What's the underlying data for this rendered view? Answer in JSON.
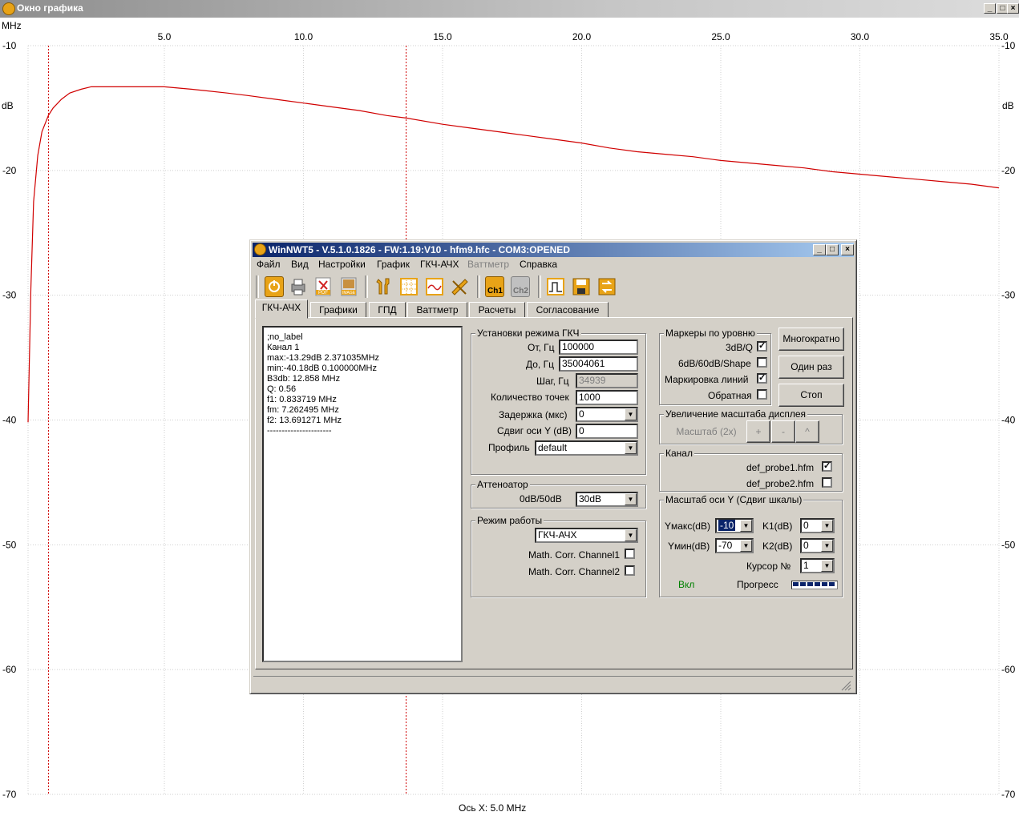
{
  "window": {
    "title": "Окно графика",
    "controls": [
      "_",
      "□",
      "×"
    ]
  },
  "plot": {
    "x_unit_label": "MHz",
    "y_unit_label": "dB",
    "footer": "Ось X: 5.0 MHz"
  },
  "chart_data": {
    "type": "line",
    "title": "",
    "xlabel": "Ось X: 5.0 MHz",
    "ylabel": "dB",
    "xlim": [
      0.1,
      35.0
    ],
    "ylim": [
      -70,
      -10
    ],
    "x_ticks": [
      "5.0",
      "10.0",
      "15.0",
      "20.0",
      "25.0",
      "30.0",
      "35.0"
    ],
    "y_ticks": [
      "-10",
      "-20",
      "-30",
      "-40",
      "-50",
      "-60",
      "-70"
    ],
    "grid": true,
    "markers_mhz": [
      0.833719,
      13.691271
    ],
    "series": [
      {
        "color": "#d00000",
        "x": [
          0.1,
          0.2,
          0.3,
          0.45,
          0.6,
          0.83,
          1.0,
          1.3,
          1.6,
          2.0,
          2.37,
          3.0,
          4.0,
          5.0,
          6.0,
          7.26,
          8.0,
          9.0,
          10.0,
          11.0,
          12.0,
          13.0,
          13.69,
          15.0,
          16.0,
          17.0,
          18.0,
          19.0,
          20.0,
          21.0,
          22.0,
          23.0,
          24.0,
          25.0,
          26.0,
          27.0,
          28.0,
          29.0,
          30.0,
          31.0,
          32.0,
          33.0,
          34.0,
          35.0
        ],
        "y": [
          -40.18,
          -29.5,
          -22.5,
          -18.8,
          -16.9,
          -15.6,
          -15.0,
          -14.3,
          -13.8,
          -13.5,
          -13.29,
          -13.3,
          -13.3,
          -13.3,
          -13.5,
          -13.8,
          -14.0,
          -14.3,
          -14.6,
          -14.9,
          -15.2,
          -15.6,
          -15.8,
          -16.3,
          -16.6,
          -16.9,
          -17.2,
          -17.5,
          -17.8,
          -18.2,
          -18.5,
          -18.7,
          -18.9,
          -19.2,
          -19.4,
          -19.6,
          -19.8,
          -20.1,
          -20.3,
          -20.5,
          -20.7,
          -20.9,
          -21.1,
          -21.4
        ]
      }
    ]
  },
  "dialog": {
    "title": "WinNWT5 - V.5.1.0.1826 - FW:1.19:V10 - hfm9.hfc - COM3:OPENED",
    "menu": [
      "Файл",
      "Вид",
      "Настройки",
      "График",
      "ГКЧ-АЧХ",
      "Ваттметр",
      "Справка"
    ],
    "toolbar": {
      "ch1": "Ch1",
      "ch2": "Ch2",
      "pdf": "PDF",
      "image": "IMAGE"
    },
    "tabs": [
      "ГКЧ-АЧХ",
      "Графики",
      "ГПД",
      "Ваттметр",
      "Расчеты",
      "Согласование"
    ],
    "memo": [
      ";no_label",
      "",
      "Канал 1",
      "max:-13.29dB 2.371035MHz",
      "min:-40.18dB 0.100000MHz",
      "B3db: 12.858 MHz",
      "Q: 0.56",
      "f1: 0.833719 MHz",
      "fm: 7.262495 MHz",
      "f2: 13.691271 MHz",
      "----------------------"
    ],
    "sweep": {
      "title": "Установки режима ГКЧ",
      "from_label": "От, Гц",
      "from_value": "100000",
      "to_label": "До, Гц",
      "to_value": "35004061",
      "step_label": "Шаг, Гц",
      "step_value": "34939",
      "points_label": "Количество точек",
      "points_value": "1000",
      "delay_label": "Задержка (мкс)",
      "delay_value": "0",
      "yshift_label": "Сдвиг оси Y (dB)",
      "yshift_value": "0",
      "profile_label": "Профиль",
      "profile_value": "default"
    },
    "attenuator": {
      "title": "Аттеноатор",
      "label": "0dB/50dB",
      "value": "30dB"
    },
    "mode": {
      "title": "Режим работы",
      "value": "ГКЧ-АЧХ",
      "corr1": "Math. Corr. Channel1",
      "corr2": "Math. Corr. Channel2"
    },
    "markers": {
      "title": "Маркеры по уровню",
      "m3db": "3dB/Q",
      "m6db": "6dB/60dB/Shape",
      "lines": "Маркировка линий",
      "reverse": "Обратная"
    },
    "buttons": {
      "multi": "Многократно",
      "once": "Один раз",
      "stop": "Стоп"
    },
    "zoom": {
      "title": "Увеличение масштаба дисплея",
      "scale": "Масштаб (2x)",
      "plus": "+",
      "minus": "-",
      "up": "^"
    },
    "channel": {
      "title": "Канал",
      "probe1": "def_probe1.hfm",
      "probe2": "def_probe2.hfm"
    },
    "yscale": {
      "title": "Масштаб оси Y (Сдвиг шкалы)",
      "ymax_label": "Yмакс(dB)",
      "ymax_value": "-10",
      "ymin_label": "Yмин(dB)",
      "ymin_value": "-70",
      "k1_label": "K1(dB)",
      "k1_value": "0",
      "k2_label": "K2(dB)",
      "k2_value": "0",
      "cursor_label": "Курсор №",
      "cursor_value": "1",
      "on_label": "Вкл",
      "progress_label": "Прогресс",
      "on_color": "#008000"
    }
  }
}
